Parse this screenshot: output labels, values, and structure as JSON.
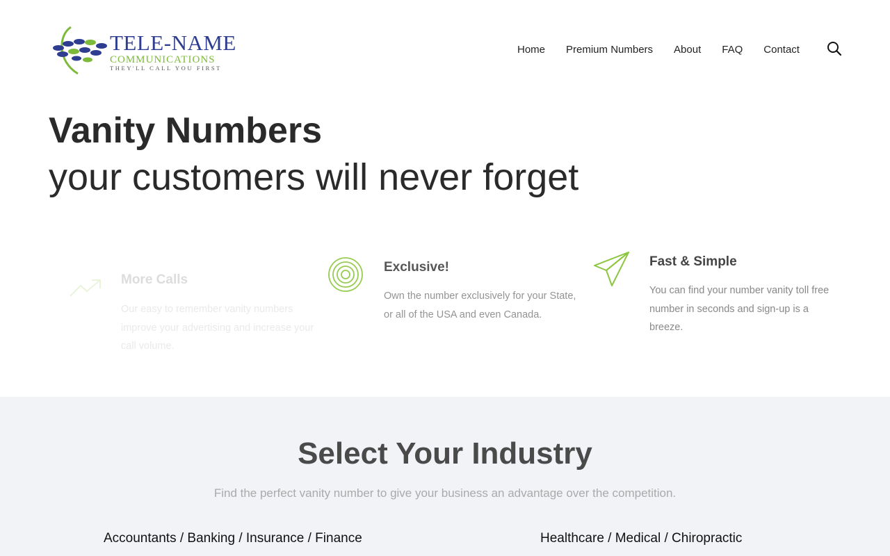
{
  "brand": {
    "name": "TELE-NAME",
    "sub": "COMMUNICATIONS",
    "tagline": "They'll Call You First",
    "colors": {
      "navy": "#2e3d8f",
      "green": "#7dba3a"
    }
  },
  "nav": {
    "items": [
      "Home",
      "Premium Numbers",
      "About",
      "FAQ",
      "Contact"
    ],
    "search_icon": "search-icon"
  },
  "hero": {
    "title": "Vanity Numbers",
    "subtitle": "your customers will never forget"
  },
  "features": [
    {
      "icon": "trending-up-icon",
      "title": "More Calls",
      "text": "Our easy to remember vanity numbers improve your advertising and increase your call volume."
    },
    {
      "icon": "target-icon",
      "title": "Exclusive!",
      "text": "Own the number exclusively for your State, or all of the USA and even Canada."
    },
    {
      "icon": "paper-plane-icon",
      "title": "Fast & Simple",
      "text": "You can find your number vanity toll free number in seconds and sign-up is a breeze."
    }
  ],
  "industry": {
    "title": "Select Your Industry",
    "subtitle": "Find the perfect vanity number to give your business an advantage over the competition.",
    "items": [
      "Accountants / Banking / Insurance / Finance",
      "Healthcare / Medical / Chiropractic"
    ]
  },
  "accent_color": "#8cc63f"
}
